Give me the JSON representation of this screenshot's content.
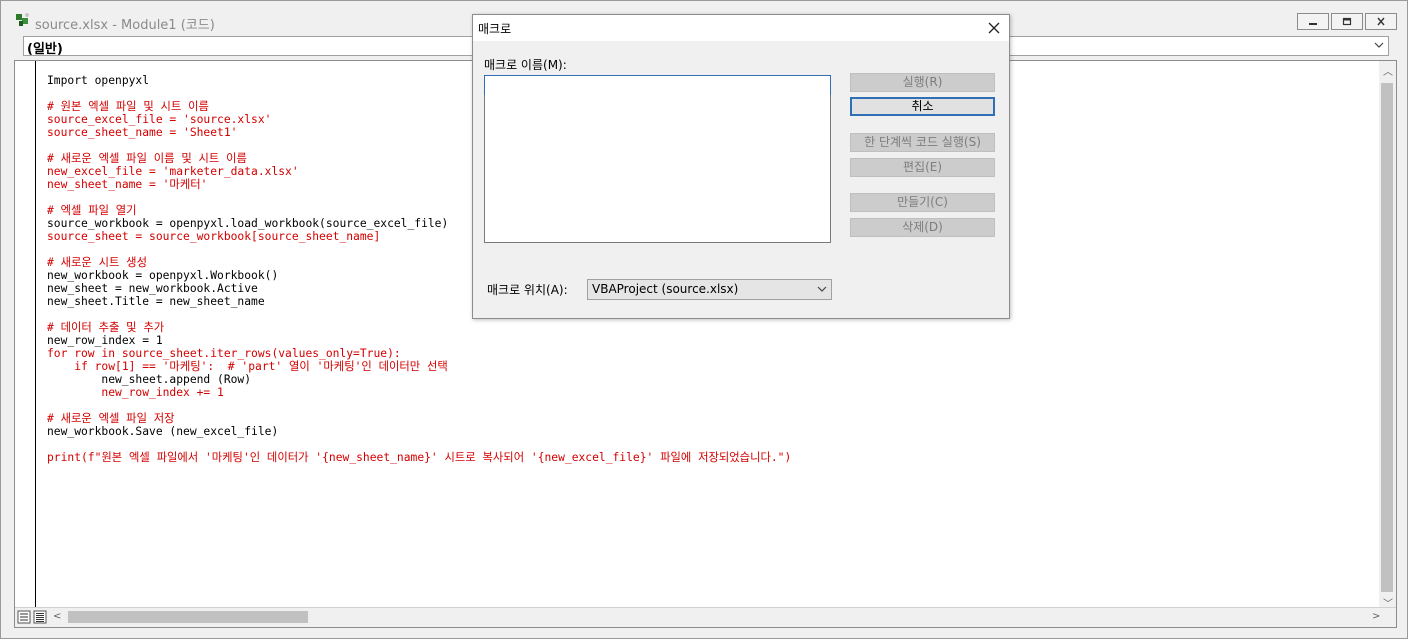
{
  "window": {
    "title": "source.xlsx - Module1 (코드)",
    "procedure_dropdown": "(일반)"
  },
  "code_lines": [
    {
      "text": "Import openpyxl",
      "color": "#000000"
    },
    {
      "text": "",
      "color": "#000000"
    },
    {
      "text": "# 원본 엑셀 파일 및 시트 이름",
      "color": "#d40000"
    },
    {
      "text": "source_excel_file = 'source.xlsx'",
      "color": "#d40000"
    },
    {
      "text": "source_sheet_name = 'Sheet1'",
      "color": "#d40000"
    },
    {
      "text": "",
      "color": "#000000"
    },
    {
      "text": "# 새로운 엑셀 파일 이름 및 시트 이름",
      "color": "#d40000"
    },
    {
      "text": "new_excel_file = 'marketer_data.xlsx'",
      "color": "#d40000"
    },
    {
      "text": "new_sheet_name = '마케터'",
      "color": "#d40000"
    },
    {
      "text": "",
      "color": "#000000"
    },
    {
      "text": "# 엑셀 파일 열기",
      "color": "#d40000"
    },
    {
      "text": "source_workbook = openpyxl.load_workbook(source_excel_file)",
      "color": "#000000"
    },
    {
      "text": "source_sheet = source_workbook[source_sheet_name]",
      "color": "#d40000"
    },
    {
      "text": "",
      "color": "#000000"
    },
    {
      "text": "# 새로운 시트 생성",
      "color": "#d40000"
    },
    {
      "text": "new_workbook = openpyxl.Workbook()",
      "color": "#000000"
    },
    {
      "text": "new_sheet = new_workbook.Active",
      "color": "#000000"
    },
    {
      "text": "new_sheet.Title = new_sheet_name",
      "color": "#000000"
    },
    {
      "text": "",
      "color": "#000000"
    },
    {
      "text": "# 데이터 추출 및 추가",
      "color": "#d40000"
    },
    {
      "text": "new_row_index = 1",
      "color": "#000000"
    },
    {
      "text": "for row in source_sheet.iter_rows(values_only=True):",
      "color": "#d40000"
    },
    {
      "text": "    if row[1] == '마케팅':  # 'part' 열이 '마케팅'인 데이터만 선택",
      "color": "#d40000"
    },
    {
      "text": "        new_sheet.append (Row)",
      "color": "#000000"
    },
    {
      "text": "        new_row_index += 1",
      "color": "#d40000"
    },
    {
      "text": "",
      "color": "#000000"
    },
    {
      "text": "# 새로운 엑셀 파일 저장",
      "color": "#d40000"
    },
    {
      "text": "new_workbook.Save (new_excel_file)",
      "color": "#000000"
    },
    {
      "text": "",
      "color": "#000000"
    },
    {
      "text": "print(f\"원본 엑셀 파일에서 '마케팅'인 데이터가 '{new_sheet_name}' 시트로 복사되어 '{new_excel_file}' 파일에 저장되었습니다.\")",
      "color": "#d40000"
    }
  ],
  "dialog": {
    "title": "매크로",
    "name_label": "매크로 이름(M):",
    "name_value": "",
    "location_label": "매크로 위치(A):",
    "location_value": "VBAProject (source.xlsx)",
    "buttons": {
      "run": "실행(R)",
      "cancel": "취소",
      "step_into": "한 단계씩 코드 실행(S)",
      "edit": "편집(E)",
      "create": "만들기(C)",
      "delete": "삭제(D)"
    }
  }
}
